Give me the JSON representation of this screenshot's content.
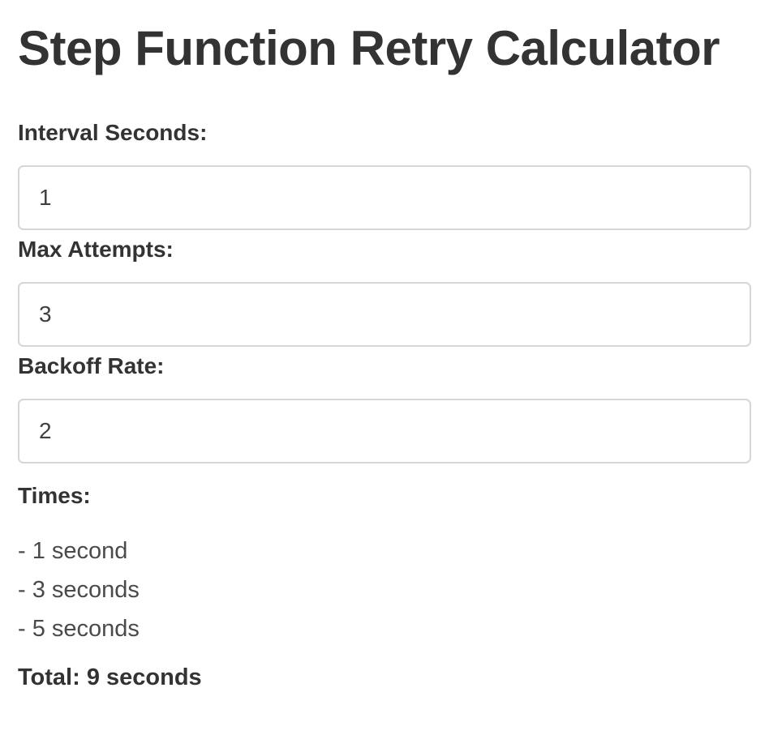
{
  "title": "Step Function Retry Calculator",
  "fields": {
    "interval": {
      "label": "Interval Seconds:",
      "value": "1"
    },
    "max_attempts": {
      "label": "Max Attempts:",
      "value": "3"
    },
    "backoff": {
      "label": "Backoff Rate:",
      "value": "2"
    }
  },
  "times": {
    "label": "Times:",
    "items": [
      "- 1 second",
      "- 3 seconds",
      "- 5 seconds"
    ]
  },
  "total": "Total: 9 seconds"
}
